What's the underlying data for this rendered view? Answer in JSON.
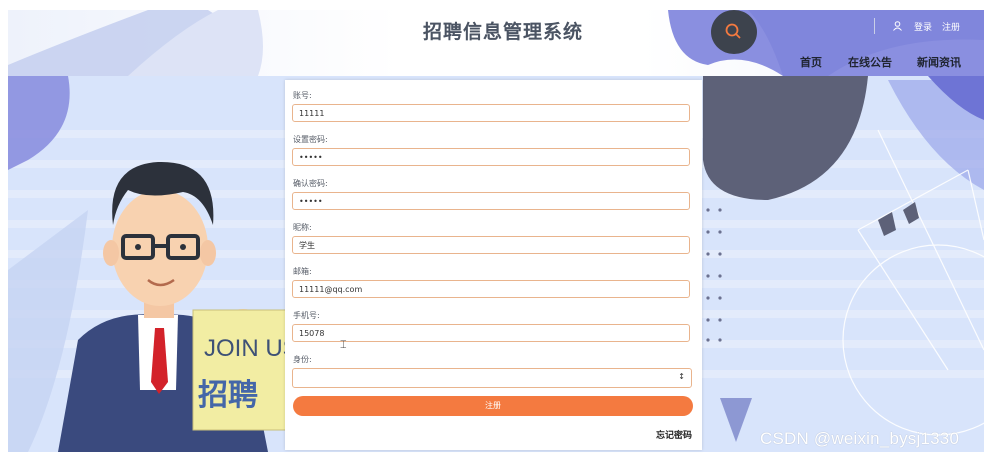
{
  "header": {
    "title": "招聘信息管理系统",
    "login": "登录",
    "register": "注册",
    "nav": [
      "首页",
      "在线公告",
      "新闻资讯"
    ]
  },
  "form": {
    "fields": [
      {
        "label": "账号:",
        "value": "11111"
      },
      {
        "label": "设置密码:",
        "value": "•••••"
      },
      {
        "label": "确认密码:",
        "value": "•••••"
      },
      {
        "label": "昵称:",
        "value": "学生"
      },
      {
        "label": "邮箱:",
        "value": "11111@qq.com"
      },
      {
        "label": "手机号:",
        "value": "15078"
      }
    ],
    "role": {
      "label": "身份:",
      "value": ""
    },
    "submit": "注册",
    "forgot": "忘记密码"
  },
  "illustration": {
    "sign_line1": "JOIN US",
    "sign_line2": "招聘"
  },
  "watermark": "CSDN @weixin_bysj1330",
  "colors": {
    "accent": "#f47a40",
    "input_border": "#e9b48d",
    "header_shape": "#8a8fe0",
    "background": "#d8e4fb"
  }
}
